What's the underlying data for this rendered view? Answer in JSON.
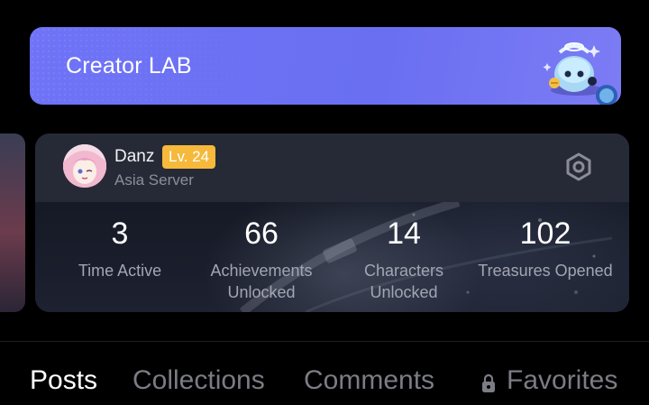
{
  "banner": {
    "title": "Creator LAB"
  },
  "profile": {
    "username": "Danz",
    "level": "Lv. 24",
    "server": "Asia Server"
  },
  "stats": [
    {
      "value": "3",
      "label_line1": "Time Active",
      "label_line2": ""
    },
    {
      "value": "66",
      "label_line1": "Achievements",
      "label_line2": "Unlocked"
    },
    {
      "value": "14",
      "label_line1": "Characters",
      "label_line2": "Unlocked"
    },
    {
      "value": "102",
      "label_line1": "Treasures Opened",
      "label_line2": ""
    }
  ],
  "tabs": [
    {
      "label": "Posts",
      "active": true
    },
    {
      "label": "Collections",
      "active": false
    },
    {
      "label": "Comments",
      "active": false
    },
    {
      "label": "Favorites",
      "active": false,
      "icon": "lock-icon"
    }
  ],
  "colors": {
    "banner": "#6f73f6",
    "level_badge": "#f6b93b",
    "card": "#262a36",
    "background": "#000000"
  }
}
